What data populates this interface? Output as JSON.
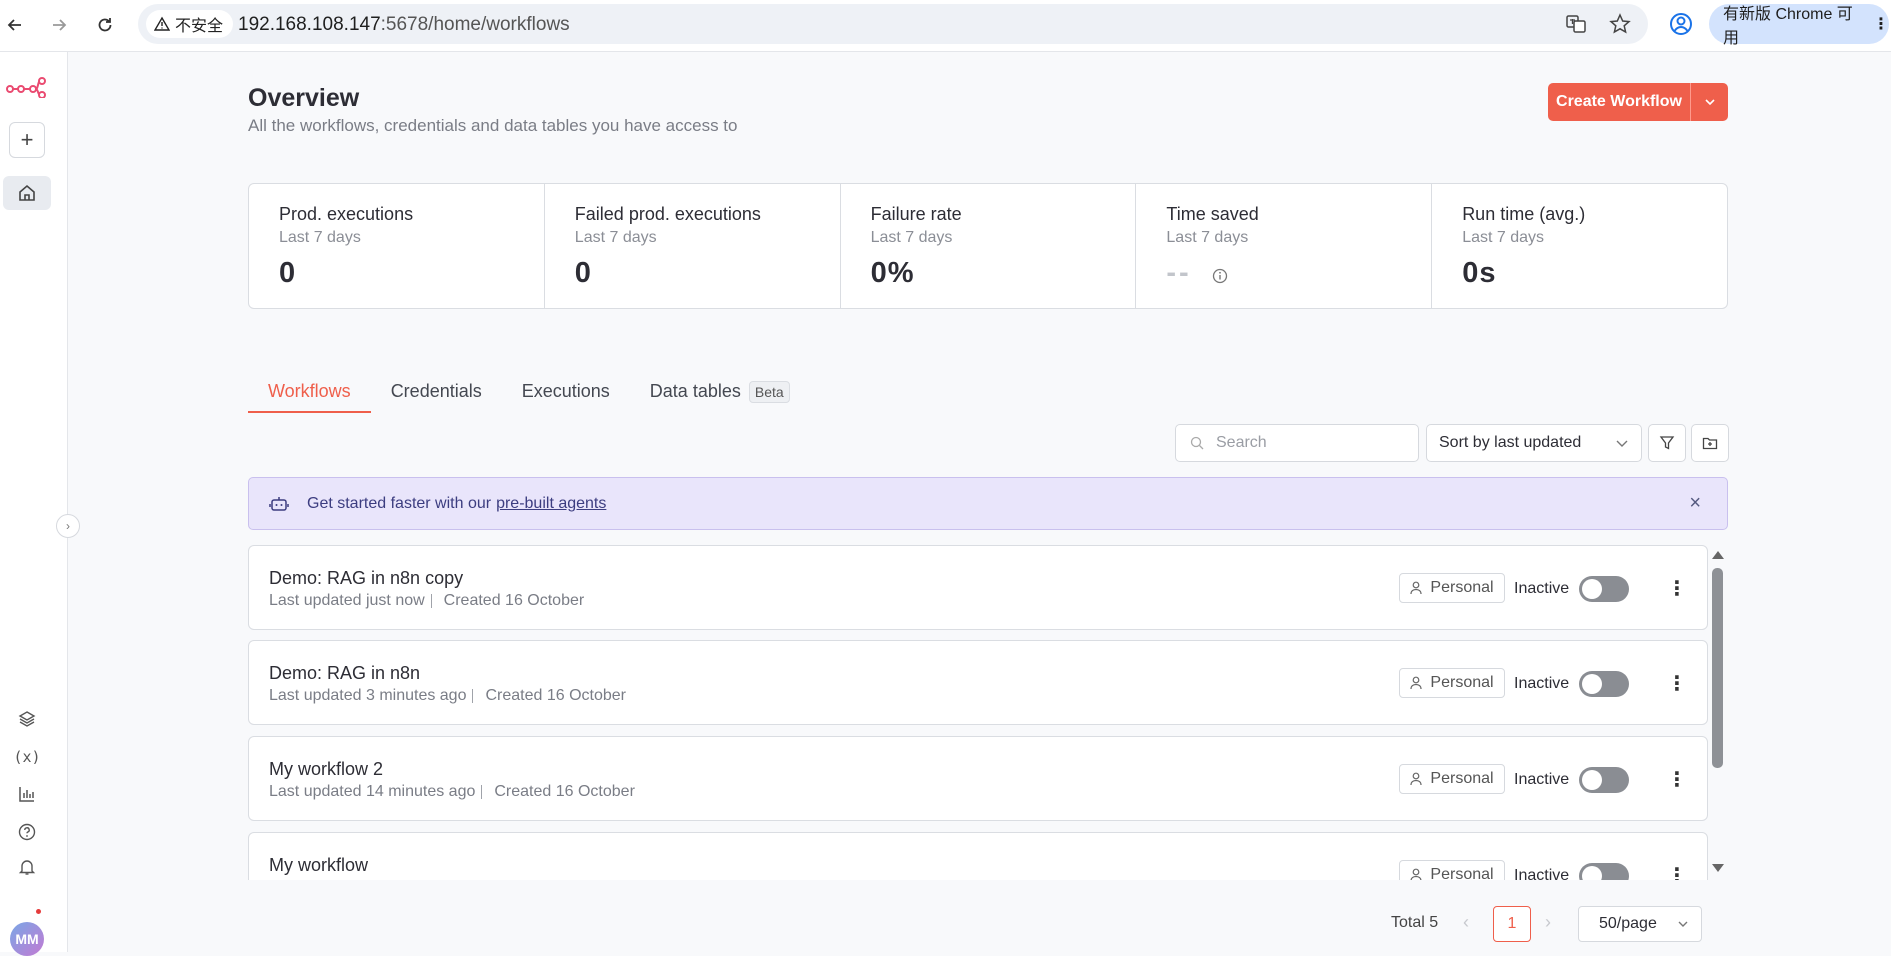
{
  "browser": {
    "insecure_label": "不安全",
    "url_host": "192.168.108.147",
    "url_path": ":5678/home/workflows",
    "update_label": "有新版 Chrome 可用"
  },
  "sidebar": {
    "avatar_initials": "MM"
  },
  "header": {
    "title": "Overview",
    "subtitle": "All the workflows, credentials and data tables you have access to",
    "create_button": "Create Workflow"
  },
  "stats": [
    {
      "label": "Prod. executions",
      "sub": "Last 7 days",
      "value": "0"
    },
    {
      "label": "Failed prod. executions",
      "sub": "Last 7 days",
      "value": "0"
    },
    {
      "label": "Failure rate",
      "sub": "Last 7 days",
      "value": "0%"
    },
    {
      "label": "Time saved",
      "sub": "Last 7 days",
      "value": "--"
    },
    {
      "label": "Run time (avg.)",
      "sub": "Last 7 days",
      "value": "0s"
    }
  ],
  "tabs": [
    {
      "label": "Workflows"
    },
    {
      "label": "Credentials"
    },
    {
      "label": "Executions"
    },
    {
      "label": "Data tables",
      "badge": "Beta"
    }
  ],
  "toolbar": {
    "search_placeholder": "Search",
    "sort_value": "Sort by last updated"
  },
  "banner": {
    "text": "Get started faster with our",
    "link": "pre-built agents"
  },
  "workflows": [
    {
      "name": "Demo: RAG in n8n copy",
      "updated": "Last updated just now",
      "created": "Created 16 October",
      "owner": "Personal",
      "status": "Inactive"
    },
    {
      "name": "Demo: RAG in n8n",
      "updated": "Last updated 3 minutes ago",
      "created": "Created 16 October",
      "owner": "Personal",
      "status": "Inactive"
    },
    {
      "name": "My workflow 2",
      "updated": "Last updated 14 minutes ago",
      "created": "Created 16 October",
      "owner": "Personal",
      "status": "Inactive"
    },
    {
      "name": "My workflow",
      "updated": "",
      "created": "",
      "owner": "Personal",
      "status": "Inactive"
    }
  ],
  "pagination": {
    "total": "Total 5",
    "current_page": "1",
    "per_page": "50/page"
  },
  "colors": {
    "accent": "#ef5f4b",
    "banner_bg": "#e9e5fb"
  }
}
